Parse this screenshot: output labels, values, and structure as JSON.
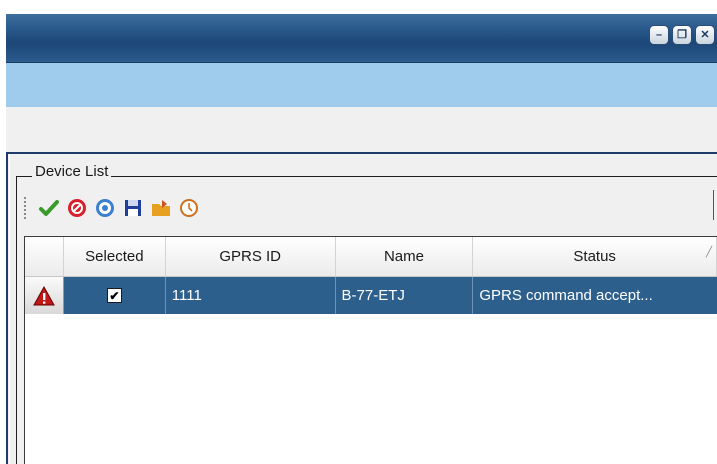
{
  "window": {
    "buttons": [
      {
        "name": "minimize",
        "glyph": "–"
      },
      {
        "name": "restore",
        "glyph": "❐"
      },
      {
        "name": "close",
        "glyph": "✕"
      }
    ]
  },
  "device_list": {
    "legend": "Device List",
    "toolbar": [
      {
        "icon": "check-icon",
        "color": "#3a9a2a"
      },
      {
        "icon": "cancel-icon",
        "color": "#d8202a"
      },
      {
        "icon": "refresh-icon",
        "color": "#3c7fd0"
      },
      {
        "icon": "save-icon",
        "color": "#1f3f9a"
      },
      {
        "icon": "folder-icon",
        "color": "#e8a020"
      },
      {
        "icon": "clock-icon",
        "color": "#d07020"
      }
    ],
    "columns": [
      "",
      "Selected",
      "GPRS ID",
      "Name",
      "Status"
    ],
    "rows": [
      {
        "alert": true,
        "selected": true,
        "gprs_id": "1111",
        "name": "B-77-ETJ",
        "status": "GPRS command accept..."
      }
    ]
  },
  "colors": {
    "title_bar": "#2a5a8c",
    "ribbon": "#9fcbec",
    "selected_row": "#2d5f8c"
  }
}
